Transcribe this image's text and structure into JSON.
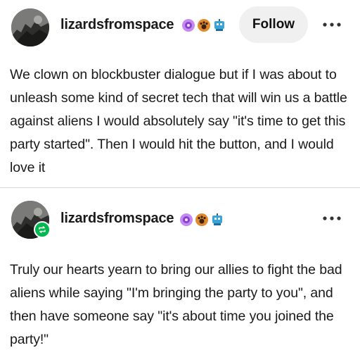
{
  "posts": [
    {
      "username": "lizardsfromspace",
      "follow_label": "Follow",
      "badges": [
        "purple-flower-badge",
        "orange-paw-badge",
        "robot-badge"
      ],
      "text": "We clown on blockbuster dialogue but if I was about to unleash some kind of secret tech that will win us a battle against aliens I would absolutely say \"it's time to get this party started\". Then I would hit the button, and I would love it"
    },
    {
      "username": "lizardsfromspace",
      "badges": [
        "purple-flower-badge",
        "orange-paw-badge",
        "robot-badge"
      ],
      "reblog_indicator": "reblog-icon",
      "text": "Truly our hearts yearn to bring our allies to fight the bad aliens while saying \"I'm bringing the party to you\", and then have someone say \"it's about time you joined the party!\""
    }
  ],
  "colors": {
    "follow_bg": "#f0f0f0",
    "reblog_green": "#00b84d",
    "divider": "#d6d6d6",
    "badge_purple": "#b06ee8",
    "badge_orange": "#e08a2c",
    "badge_blue": "#3aa3d8"
  }
}
